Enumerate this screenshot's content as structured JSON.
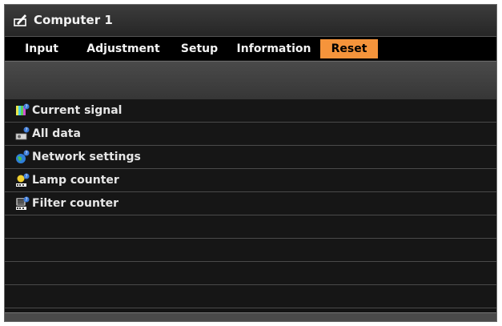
{
  "window": {
    "title": "Computer 1",
    "title_icon": "pen-document-icon"
  },
  "tabs": [
    {
      "label": "Input",
      "active": false
    },
    {
      "label": "Adjustment",
      "active": false
    },
    {
      "label": "Setup",
      "active": false
    },
    {
      "label": "Information",
      "active": false
    },
    {
      "label": "Reset",
      "active": true
    }
  ],
  "menu": {
    "items": [
      {
        "label": "Current signal",
        "icon": "color-bars-reset-icon"
      },
      {
        "label": "All data",
        "icon": "projector-reset-icon"
      },
      {
        "label": "Network settings",
        "icon": "globe-reset-icon"
      },
      {
        "label": "Lamp counter",
        "icon": "lamp-counter-reset-icon"
      },
      {
        "label": "Filter counter",
        "icon": "filter-counter-reset-icon"
      }
    ]
  },
  "colors": {
    "accent": "#f5943b",
    "background": "#141414",
    "text": "#e6e6e6"
  }
}
